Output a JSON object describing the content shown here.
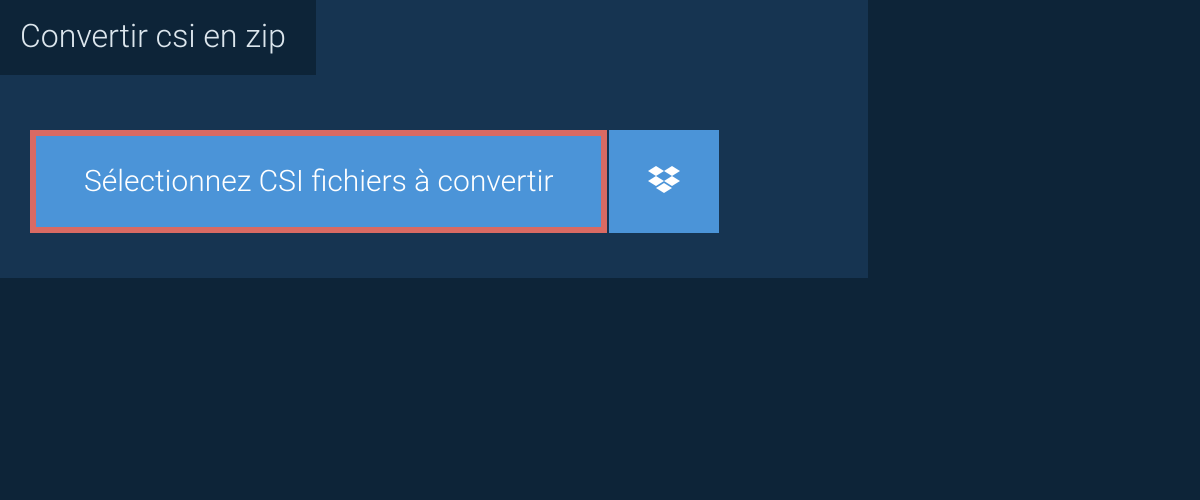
{
  "header": {
    "title": "Convertir csi en zip"
  },
  "actions": {
    "select_files_label": "Sélectionnez CSI fichiers à convertir"
  }
}
